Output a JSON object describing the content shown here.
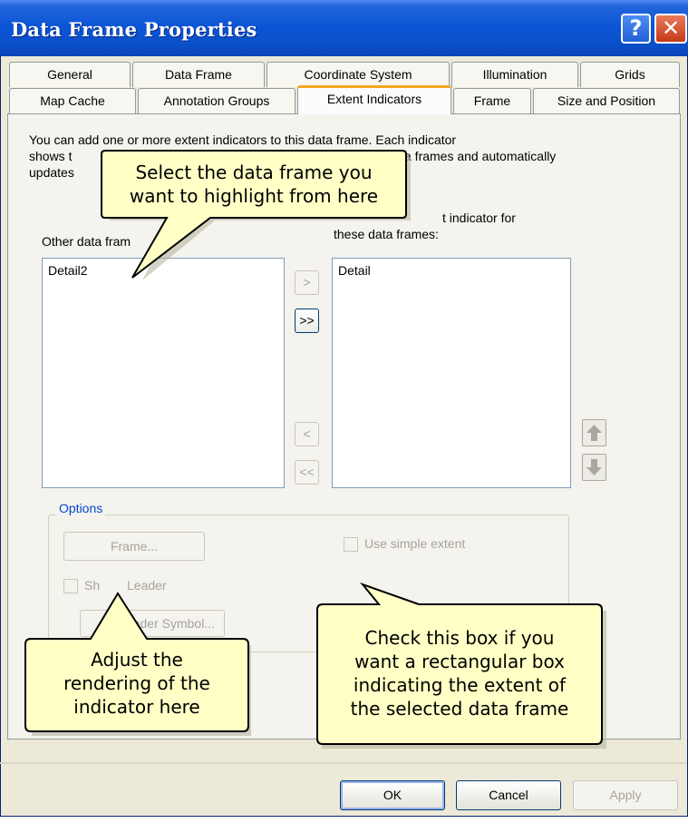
{
  "window": {
    "title": "Data Frame Properties",
    "help_glyph": "?",
    "close_glyph": "✕"
  },
  "tabs": {
    "row1": [
      "General",
      "Data Frame",
      "Coordinate System",
      "Illumination",
      "Grids"
    ],
    "row2": [
      "Map Cache",
      "Annotation Groups",
      "Extent Indicators",
      "Frame",
      "Size and Position"
    ],
    "active": "Extent Indicators"
  },
  "panel": {
    "description_line1": "You can add one or more extent indicators to this data frame.  Each indicator",
    "description_line2_left": "shows t",
    "description_line2_right": "a frames and automatically",
    "description_line3": "updates",
    "right_label_line1": "t indicator for",
    "right_label_line2": "these data frames:",
    "left_label": "Other data fram",
    "left_list": [
      "Detail2"
    ],
    "right_list": [
      "Detail"
    ],
    "move_right": ">",
    "move_all_right": ">>",
    "move_left": "<",
    "move_all_left": "<<"
  },
  "options": {
    "legend": "Options",
    "frame_button": "Frame...",
    "use_simple_extent": "Use simple extent",
    "show_leader_a": "Sh",
    "show_leader_b": "Leader",
    "leader_symbol_button": "eader Symbol..."
  },
  "callouts": {
    "top": [
      "Select the data frame you",
      "want to highlight from here"
    ],
    "bottom_left": [
      "Adjust the",
      "rendering of the",
      "indicator here"
    ],
    "bottom_right": [
      "Check this box if you",
      "want a rectangular box",
      "indicating the extent of",
      "the selected data frame"
    ]
  },
  "buttons": {
    "ok": "OK",
    "cancel": "Cancel",
    "apply": "Apply"
  },
  "colors": {
    "titlebar": "#0b55d6",
    "callout_fill": "#ffffc6",
    "active_tab_accent": "#f5a623",
    "options_legend": "#0046d5"
  }
}
